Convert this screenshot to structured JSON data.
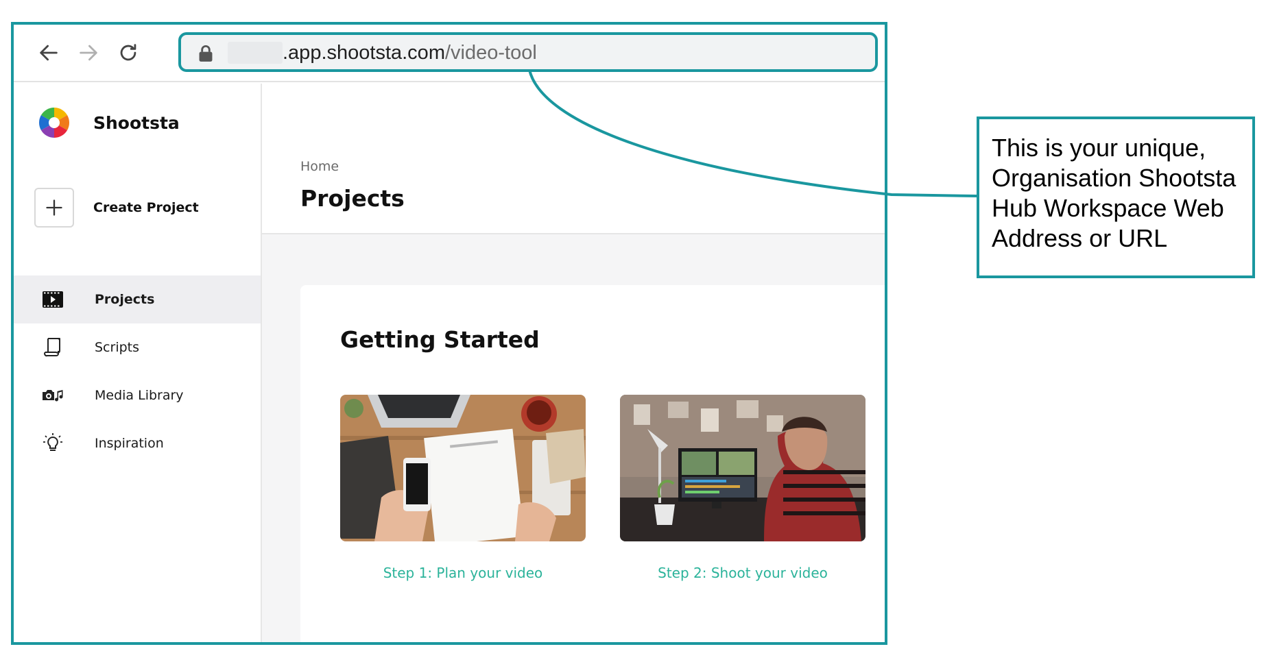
{
  "browser": {
    "url_host": ".app.shootsta.com",
    "url_path": "/video-tool"
  },
  "sidebar": {
    "brand": "Shootsta",
    "create_label": "Create Project",
    "items": [
      {
        "label": "Projects",
        "icon": "film-play-icon",
        "active": true
      },
      {
        "label": "Scripts",
        "icon": "scroll-icon",
        "active": false
      },
      {
        "label": "Media Library",
        "icon": "camera-music-icon",
        "active": false
      },
      {
        "label": "Inspiration",
        "icon": "lightbulb-icon",
        "active": false
      }
    ]
  },
  "main": {
    "breadcrumb": "Home",
    "title": "Projects",
    "card": {
      "title": "Getting Started",
      "steps": [
        {
          "label": "Step 1: Plan your video"
        },
        {
          "label": "Step 2: Shoot your video"
        }
      ]
    }
  },
  "callout": {
    "text": "This is your unique, Organisation Shootsta Hub Workspace Web Address or URL"
  },
  "colors": {
    "outline": "#1a979f",
    "link": "#2bb39a",
    "active_bg": "#eeeef1"
  }
}
